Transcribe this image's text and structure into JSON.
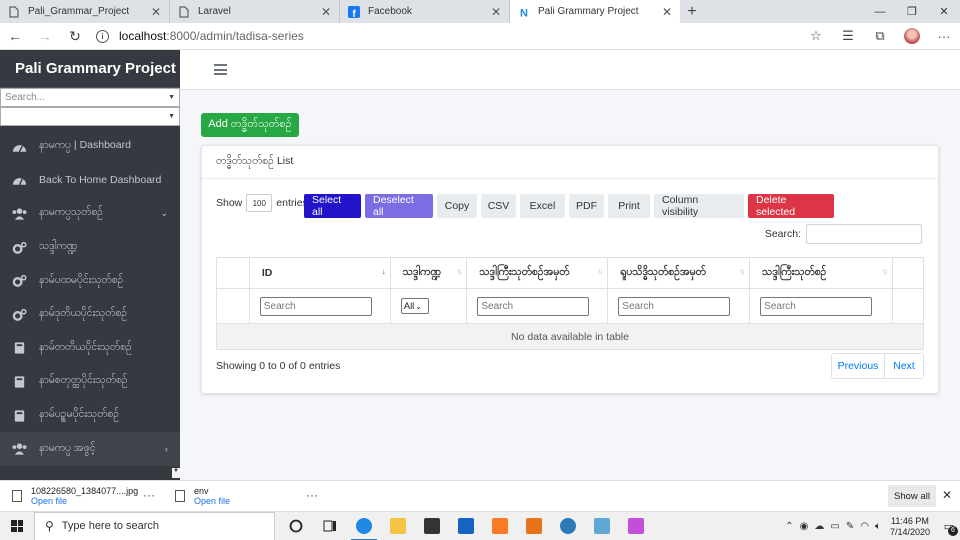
{
  "browser": {
    "tabs": [
      {
        "label": "Pali_Grammar_Project",
        "icon": "document-icon",
        "active": false
      },
      {
        "label": "Laravel",
        "icon": "document-icon",
        "active": false
      },
      {
        "label": "Facebook",
        "icon": "facebook-icon",
        "active": false
      },
      {
        "label": "Pali Grammary Project",
        "icon": "app-n-icon",
        "active": true
      }
    ],
    "url_host": "localhost",
    "url_path": ":8000/admin/tadisa-series"
  },
  "sidebar": {
    "brand": "Pali Grammary Project",
    "search_placeholder": "Search...",
    "items": [
      {
        "label": "နာမကပ္ပ | Dashboard",
        "icon": "dashboard-icon",
        "chevron": ""
      },
      {
        "label": "Back To Home Dashboard",
        "icon": "dashboard-icon",
        "chevron": ""
      },
      {
        "label": "နာမကပ္ပသုတ်စဉ်",
        "icon": "users-icon",
        "chevron": "⌄"
      },
      {
        "label": "သဒ္ဒါကဏ္ဍ",
        "icon": "cogs-icon",
        "chevron": ""
      },
      {
        "label": "နာမ်ပထမပိုင်းသုတ်စဉ်",
        "icon": "cogs-icon",
        "chevron": ""
      },
      {
        "label": "နာမ်ဒုတိယပိုင်းသုတ်စဉ်",
        "icon": "cogs-icon",
        "chevron": ""
      },
      {
        "label": "နာမ်တတိယပိုင်းသုတ်စဉ်",
        "icon": "book-icon",
        "chevron": ""
      },
      {
        "label": "နာမ်စတုတ္ထပိုင်းသုတ်စဉ်",
        "icon": "book-icon",
        "chevron": ""
      },
      {
        "label": "နာမ်ပဥ္စမပိုင်းသုတ်စဉ်",
        "icon": "book-icon",
        "chevron": ""
      },
      {
        "label": "နာမကပ္ပ အဖွင့်",
        "icon": "users-icon",
        "chevron": "‹"
      }
    ]
  },
  "main": {
    "add_button": "Add တဒ္ဓိတ်သုတ်စဉ်",
    "card_title": "တဒ္ဓိတ်သုတ်စဉ် List",
    "show_label": "Show",
    "entries_value": "100",
    "entries_label": "entries",
    "buttons": {
      "select_all": "Select all",
      "deselect_all": "Deselect all",
      "copy": "Copy",
      "csv": "CSV",
      "excel": "Excel",
      "pdf": "PDF",
      "print": "Print",
      "column_visibility": "Column visibility",
      "delete_selected": "Delete selected"
    },
    "search_label": "Search:",
    "columns": [
      "",
      "ID",
      "သဒ္ဒါကဏ္ဍ",
      "သဒ္ဒါကြီးသုတ်စဉ်အမှတ်",
      "ရူပသိဒ္ဓိသုတ်စဉ်အမှတ်",
      "သဒ္ဒါကြီးသုတ်စဉ်",
      ""
    ],
    "filter_placeholder": "Search",
    "filter_select_value": "All",
    "empty_message": "No data available in table",
    "info": "Showing 0 to 0 of 0 entries",
    "pager": {
      "previous": "Previous",
      "next": "Next"
    }
  },
  "downloads": {
    "items": [
      {
        "name": "108226580_1384077....jpg",
        "action": "Open file"
      },
      {
        "name": "env",
        "action": "Open file"
      }
    ],
    "show_all": "Show all"
  },
  "taskbar": {
    "search_placeholder": "Type here to search",
    "time": "11:46 PM",
    "date": "7/14/2020",
    "notification_count": "6"
  },
  "colors": {
    "sidebar_bg": "#343a40",
    "add_button": "#28a745",
    "select_all": "#2414c9",
    "deselect_all": "#7b6ee3",
    "delete_selected": "#dc3545",
    "link": "#007bff"
  }
}
